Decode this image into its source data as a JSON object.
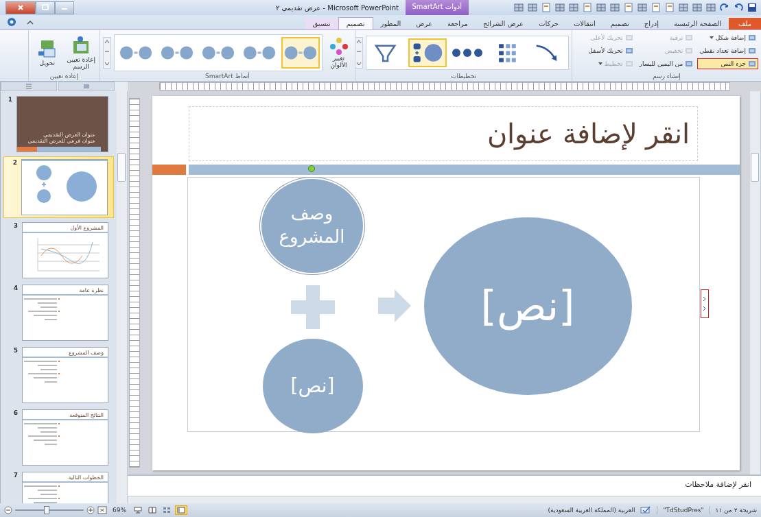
{
  "window": {
    "title": "Microsoft PowerPoint - عرض تقديمي ٢",
    "contextual_tab": "أدوات SmartArt"
  },
  "tabs": [
    {
      "label": "ملف",
      "kind": "file",
      "selected": false,
      "contextual": false
    },
    {
      "label": "الصفحة الرئيسية",
      "kind": "tab",
      "selected": false,
      "contextual": false
    },
    {
      "label": "إدراج",
      "kind": "tab",
      "selected": false,
      "contextual": false
    },
    {
      "label": "تصميم",
      "kind": "tab",
      "selected": false,
      "contextual": false
    },
    {
      "label": "انتقالات",
      "kind": "tab",
      "selected": false,
      "contextual": false
    },
    {
      "label": "حركات",
      "kind": "tab",
      "selected": false,
      "contextual": false
    },
    {
      "label": "عرض الشرائح",
      "kind": "tab",
      "selected": false,
      "contextual": false
    },
    {
      "label": "مراجعة",
      "kind": "tab",
      "selected": false,
      "contextual": false
    },
    {
      "label": "عرض",
      "kind": "tab",
      "selected": false,
      "contextual": false
    },
    {
      "label": "المطور",
      "kind": "tab",
      "selected": false,
      "contextual": false
    },
    {
      "label": "تصميم",
      "kind": "tab",
      "selected": true,
      "contextual": true
    },
    {
      "label": "تنسيق",
      "kind": "tab",
      "selected": false,
      "contextual": true
    }
  ],
  "ribbon": {
    "create_graphic": {
      "label": "إنشاء رسم",
      "columns": [
        [
          {
            "label": "إضافة شكل",
            "dropdown": true,
            "disabled": false,
            "highlighted": false
          },
          {
            "label": "إضافة تعداد نقطي",
            "dropdown": false,
            "disabled": false,
            "highlighted": false
          },
          {
            "label": "جزء النص",
            "dropdown": false,
            "disabled": false,
            "highlighted": true
          }
        ],
        [
          {
            "label": "ترقية",
            "dropdown": false,
            "disabled": true,
            "highlighted": false
          },
          {
            "label": "تخفيض",
            "dropdown": false,
            "disabled": true,
            "highlighted": false
          },
          {
            "label": "من اليمين لليسار",
            "dropdown": false,
            "disabled": false,
            "highlighted": false
          }
        ],
        [
          {
            "label": "تحريك لأعلى",
            "dropdown": false,
            "disabled": true,
            "highlighted": false
          },
          {
            "label": "تحريك لأسفل",
            "dropdown": false,
            "disabled": false,
            "highlighted": false
          },
          {
            "label": "تخطيط",
            "dropdown": true,
            "disabled": true,
            "highlighted": false
          }
        ]
      ]
    },
    "layouts": {
      "label": "تخطيطات",
      "items": [
        {
          "kind": "curve",
          "selected": false
        },
        {
          "kind": "list",
          "selected": false
        },
        {
          "kind": "process",
          "selected": false
        },
        {
          "kind": "plus",
          "selected": true
        },
        {
          "kind": "funnel",
          "selected": false
        }
      ]
    },
    "change_colors": {
      "label": "تغيير الألوان"
    },
    "styles": {
      "label": "أنماط SmartArt",
      "items": [
        {
          "selected": true
        },
        {
          "selected": false
        },
        {
          "selected": false
        },
        {
          "selected": false
        },
        {
          "selected": false
        }
      ]
    },
    "reset": {
      "label": "إعادة تعيين",
      "buttons": [
        {
          "label": "إعادة تعيين الرسم",
          "kind": "reset"
        },
        {
          "label": "تحويل",
          "kind": "convert"
        }
      ]
    }
  },
  "thumbnails": [
    {
      "number": "1",
      "kind": "title",
      "selected": false,
      "texts": [
        "عنوان العرض التقديمي",
        "عنوان فرعي للعرض التقديمي"
      ]
    },
    {
      "number": "2",
      "kind": "smartart",
      "selected": true
    },
    {
      "number": "3",
      "kind": "chart",
      "selected": false,
      "texts": [
        "المشروع الأول"
      ]
    },
    {
      "number": "4",
      "kind": "bullets",
      "selected": false,
      "texts": [
        "نظرة عامة"
      ]
    },
    {
      "number": "5",
      "kind": "bullets",
      "selected": false,
      "texts": [
        "وصف المشروع"
      ]
    },
    {
      "number": "6",
      "kind": "bullets",
      "selected": false,
      "texts": [
        "النتائج المتوقعة"
      ]
    },
    {
      "number": "7",
      "kind": "bullets",
      "selected": false,
      "texts": [
        "الخطوات التالية"
      ]
    }
  ],
  "slide": {
    "title_placeholder": "انقر لإضافة عنوان",
    "smartart": {
      "shapes": [
        {
          "kind": "small_circle",
          "text": "وصف المشروع",
          "selected": true
        },
        {
          "kind": "plus"
        },
        {
          "kind": "arrow"
        },
        {
          "kind": "big_circle",
          "text": "[نص]",
          "selected": false
        },
        {
          "kind": "bottom_circle",
          "text": "[نص]",
          "selected": false
        }
      ]
    }
  },
  "notes": {
    "placeholder": "انقر لإضافة ملاحظات"
  },
  "status_bar": {
    "slide_info": "شريحة ٢ من ١١",
    "theme": "\"TdStudPres\"",
    "language": "العربية (المملكة العربية السعودية)",
    "zoom": "69%",
    "zoom_slider": {
      "level": 0.45
    },
    "views": [
      {
        "kind": "normal",
        "selected": true
      },
      {
        "kind": "sorter",
        "selected": false
      },
      {
        "kind": "reading",
        "selected": false
      },
      {
        "kind": "show",
        "selected": false
      }
    ]
  }
}
